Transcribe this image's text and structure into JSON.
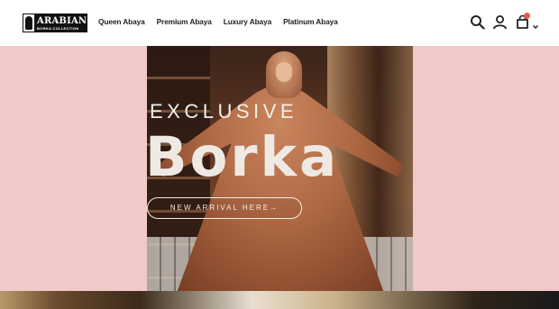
{
  "logo": {
    "title": "ARABIAN",
    "subtitle": "BORKA COLLECTION"
  },
  "nav": {
    "items": [
      {
        "label": "Queen Abaya"
      },
      {
        "label": "Premium Abaya"
      },
      {
        "label": "Luxury Abaya"
      },
      {
        "label": "Platinum Abaya"
      }
    ]
  },
  "header_icons": [
    "search-icon",
    "account-icon",
    "cart-icon",
    "chevron-down-icon"
  ],
  "colors": {
    "hero_background": "#f1c9c9",
    "cart_badge": "#e25b4b",
    "hero_text": "#efe9e4"
  },
  "hero": {
    "kicker": "EXCLUSIVE",
    "title": "Borka",
    "cta_label": "NEW ARRIVAL HERE→"
  }
}
